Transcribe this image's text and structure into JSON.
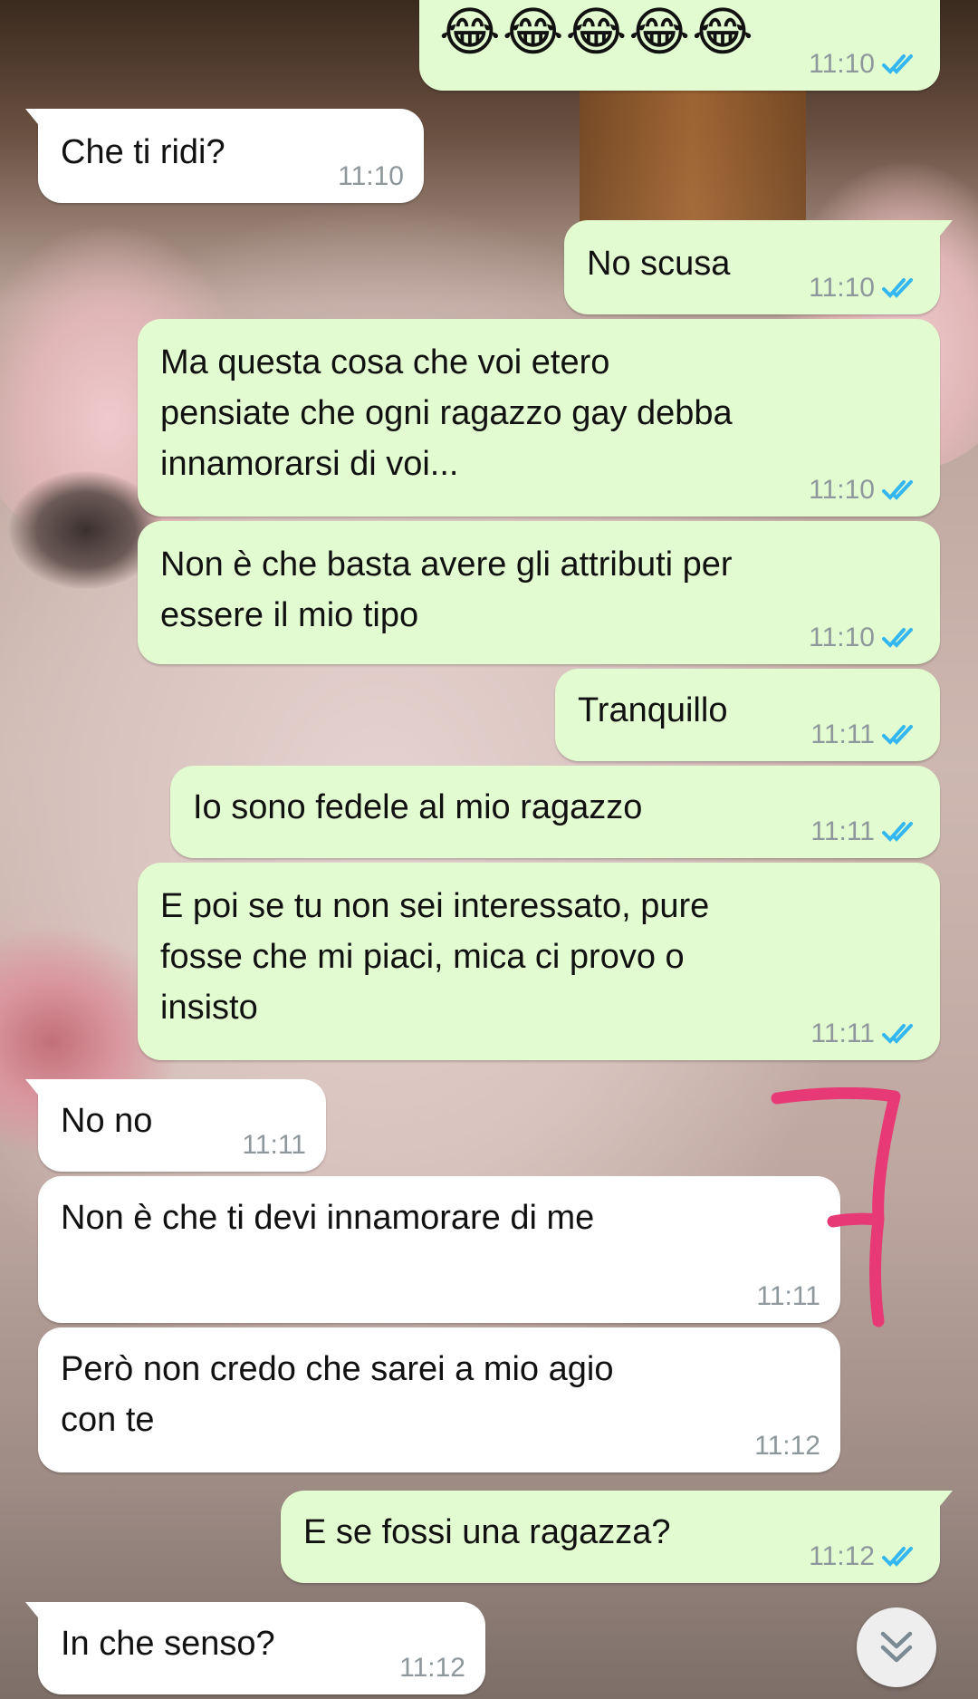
{
  "colors": {
    "outgoing_bubble": "#e2fbd0",
    "incoming_bubble": "#ffffff",
    "read_tick": "#34b7f1",
    "timestamp": "#8e979c",
    "annotation": "#e63975"
  },
  "messages": [
    {
      "direction": "out",
      "text": "😂😂😂😂😂",
      "time": "11:10",
      "status": "read"
    },
    {
      "direction": "in",
      "text": "Che ti ridi?",
      "time": "11:10"
    },
    {
      "direction": "out",
      "text": "No scusa",
      "time": "11:10",
      "status": "read"
    },
    {
      "direction": "out",
      "text": "Ma questa cosa che voi etero\npensiate che ogni ragazzo gay debba\ninnamorarsi di voi...",
      "time": "11:10",
      "status": "read"
    },
    {
      "direction": "out",
      "text": "Non è che basta avere gli attributi per\nessere il mio tipo",
      "time": "11:10",
      "status": "read"
    },
    {
      "direction": "out",
      "text": "Tranquillo",
      "time": "11:11",
      "status": "read"
    },
    {
      "direction": "out",
      "text": "Io sono fedele al mio ragazzo",
      "time": "11:11",
      "status": "read"
    },
    {
      "direction": "out",
      "text": "E poi se tu non sei interessato, pure\nfosse che mi piaci, mica ci provo o\ninsisto",
      "time": "11:11",
      "status": "read"
    },
    {
      "direction": "in",
      "text": "No no",
      "time": "11:11"
    },
    {
      "direction": "in",
      "text": "Non è che ti devi innamorare di me",
      "time": "11:11"
    },
    {
      "direction": "in",
      "text": "Però non credo che sarei a mio agio\ncon te",
      "time": "11:12"
    },
    {
      "direction": "out",
      "text": "E se fossi una ragazza?",
      "time": "11:12",
      "status": "read"
    },
    {
      "direction": "in",
      "text": "In che senso?",
      "time": "11:12"
    }
  ],
  "annotation": {
    "text": "7"
  },
  "scroll_button": {
    "icon": "double-chevron-down-icon"
  }
}
